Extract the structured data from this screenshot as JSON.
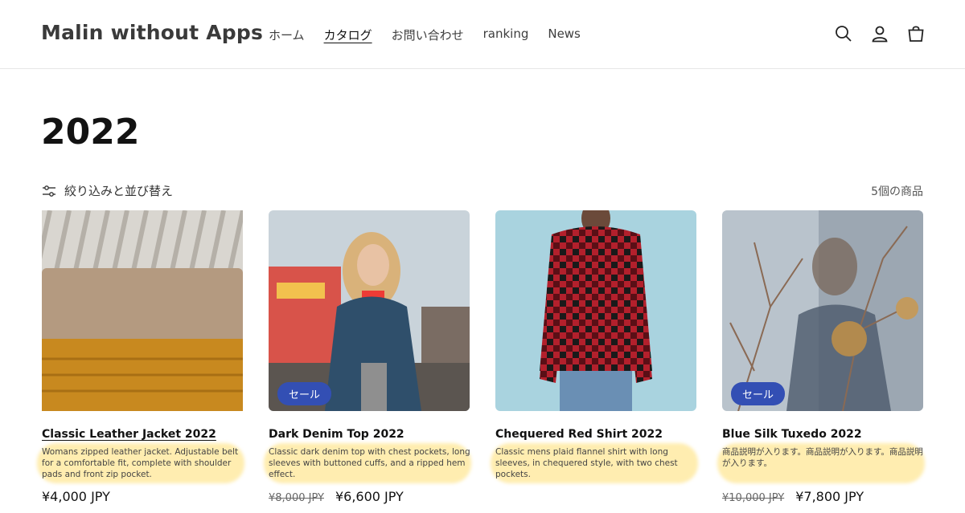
{
  "header": {
    "logo": "Malin without Apps",
    "nav": [
      {
        "label": "ホーム",
        "active": false
      },
      {
        "label": "カタログ",
        "active": true
      },
      {
        "label": "お問い合わせ",
        "active": false
      },
      {
        "label": "ranking",
        "active": false
      },
      {
        "label": "News",
        "active": false
      }
    ],
    "icons": [
      "search-icon",
      "account-icon",
      "cart-icon"
    ]
  },
  "collection": {
    "title": "2022",
    "filter_label": "絞り込みと並び替え",
    "product_count": "5個の商品"
  },
  "products": [
    {
      "title": "Classic Leather Jacket 2022",
      "description": "Womans zipped leather jacket. Adjustable belt for a comfortable fit, complete with shoulder pads and front zip pocket.",
      "compare_price": "",
      "price": "¥4,000 JPY",
      "badge": ""
    },
    {
      "title": "Dark Denim Top 2022",
      "description": "Classic dark denim top with chest pockets, long sleeves with buttoned cuffs, and a ripped hem effect.",
      "compare_price": "¥8,000 JPY",
      "price": "¥6,600 JPY",
      "badge": "セール"
    },
    {
      "title": "Chequered Red Shirt 2022",
      "description": "Classic mens plaid flannel shirt with long sleeves, in chequered style, with two chest pockets.",
      "compare_price": "",
      "price": "",
      "badge": ""
    },
    {
      "title": "Blue Silk Tuxedo 2022",
      "description": "商品説明が入ります。商品説明が入ります。商品説明が入ります。",
      "compare_price": "¥10,000 JPY",
      "price": "¥7,800 JPY",
      "badge": "セール"
    }
  ],
  "colors": {
    "badge": "#334fb4",
    "highlight": "#ffd650"
  }
}
